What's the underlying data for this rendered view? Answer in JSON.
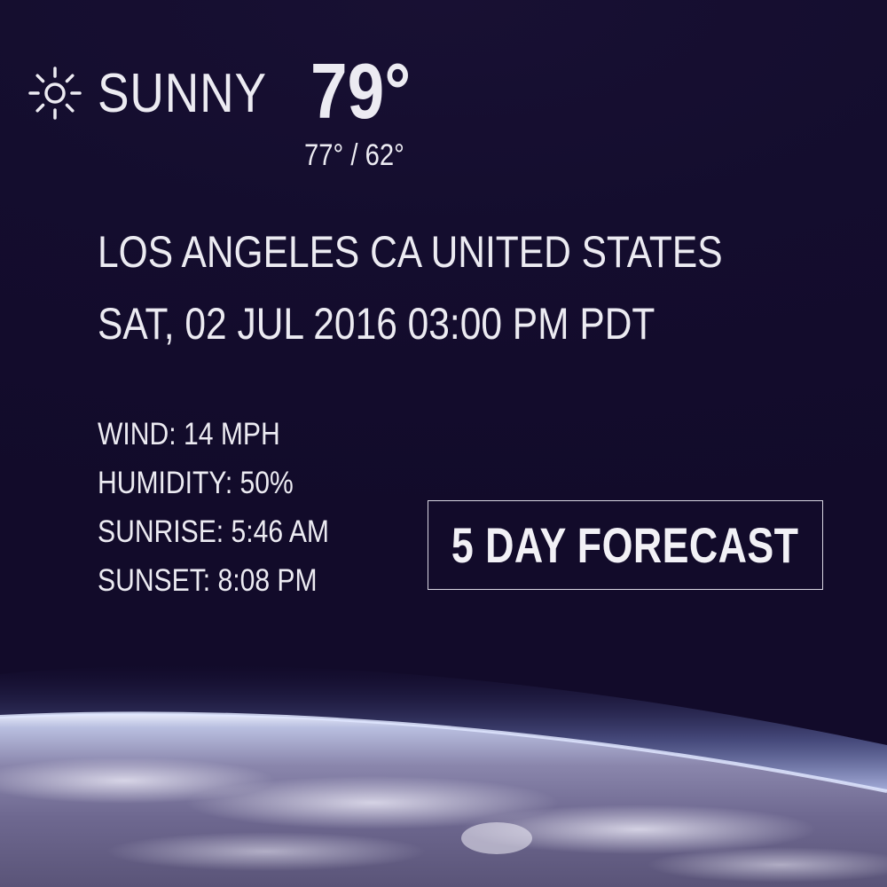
{
  "weather": {
    "condition": "SUNNY",
    "condition_icon": "sun-icon",
    "temperature": "79°",
    "high_low": "77° / 62°"
  },
  "location": {
    "name": "LOS ANGELES CA UNITED STATES",
    "datetime": "SAT, 02 JUL 2016 03:00 PM PDT"
  },
  "details": {
    "wind": "WIND: 14 MPH",
    "humidity": "HUMIDITY: 50%",
    "sunrise": "SUNRISE: 5:46 AM",
    "sunset": "SUNSET: 8:08 PM"
  },
  "forecast_button": {
    "label": "5 DAY FORECAST"
  },
  "colors": {
    "background": "#120c2a",
    "text": "#ecebf2",
    "atmosphere_glow": "#9fb4f2"
  }
}
